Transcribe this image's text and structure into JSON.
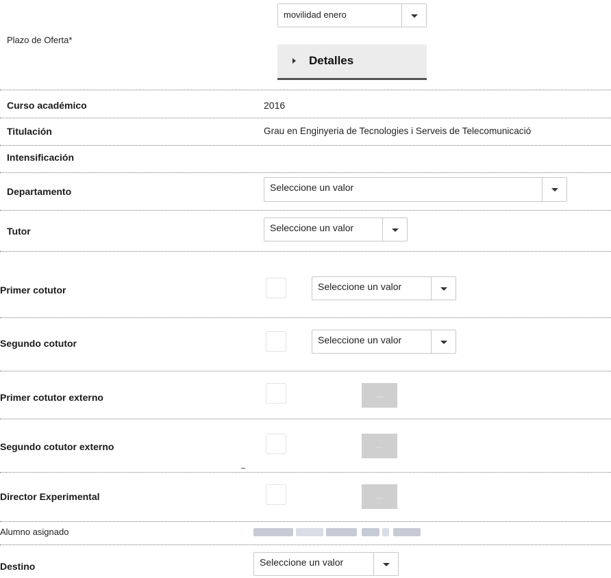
{
  "plazo": {
    "label": "Plazo de Oferta*",
    "selected": "movilidad enero",
    "details_button": "Detalles"
  },
  "fields": {
    "curso_label": "Curso académico",
    "curso_value": "2016",
    "titulacion_label": "Titulación",
    "titulacion_value": "Grau en Enginyeria de Tecnologies i Serveis de Telecomunicació",
    "intensificacion_label": "Intensificación",
    "departamento_label": "Departamento",
    "departamento_value": "Seleccione un valor",
    "tutor_label": "Tutor",
    "tutor_value": "Seleccione un valor",
    "primer_cotutor_label": "Primer cotutor",
    "primer_cotutor_value": "Seleccione un valor",
    "segundo_cotutor_label": "Segundo cotutor",
    "segundo_cotutor_value": "Seleccione un valor",
    "primer_cotutor_externo_label": "Primer cotutor externo",
    "segundo_cotutor_externo_label": "Segundo cotutor externo",
    "director_experimental_label": "Director Experimental",
    "lookup_button_label": "...",
    "alumno_label": "Alumno asignado",
    "destino_label": "Destino",
    "destino_value": "Seleccione un valor"
  }
}
